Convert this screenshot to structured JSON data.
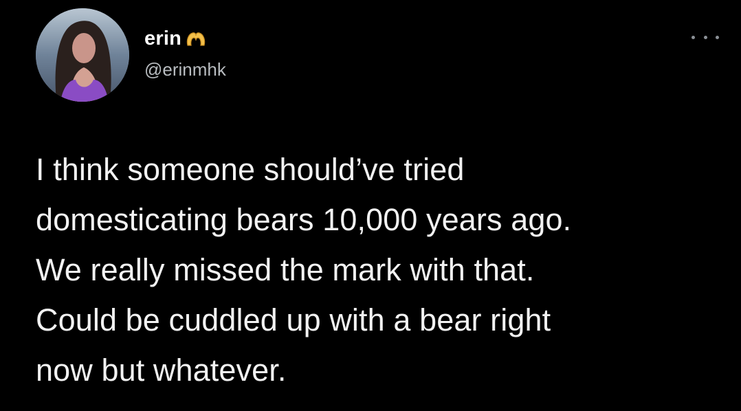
{
  "author": {
    "display_name": "erin",
    "handle": "@erinmhk",
    "avatar_icon": "profile-photo",
    "name_emoji_icon": "heart-hands-icon"
  },
  "menu": {
    "icon": "more-options-icon"
  },
  "tweet": {
    "text": "I think someone should’ve tried\ndomesticating bears 10,000 years ago.\nWe really missed the mark with that.\nCould be cuddled up with a bear right\nnow but whatever."
  },
  "colors": {
    "background": "#000000",
    "text": "#f2f2f2",
    "handle": "#b8bcc0"
  }
}
